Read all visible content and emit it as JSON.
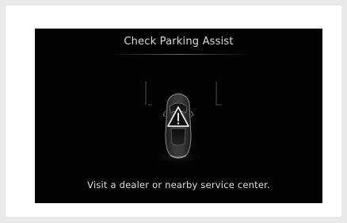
{
  "display": {
    "title": "Check Parking Assist",
    "message": "Visit a dealer or nearby service center."
  },
  "icons": {
    "car": "car-top-view-icon",
    "warning": "warning-triangle-icon"
  },
  "colors": {
    "page_background": "#e9e9e9",
    "card_background": "#ffffff",
    "screen_background": "#030303",
    "text": "#dddddd"
  }
}
